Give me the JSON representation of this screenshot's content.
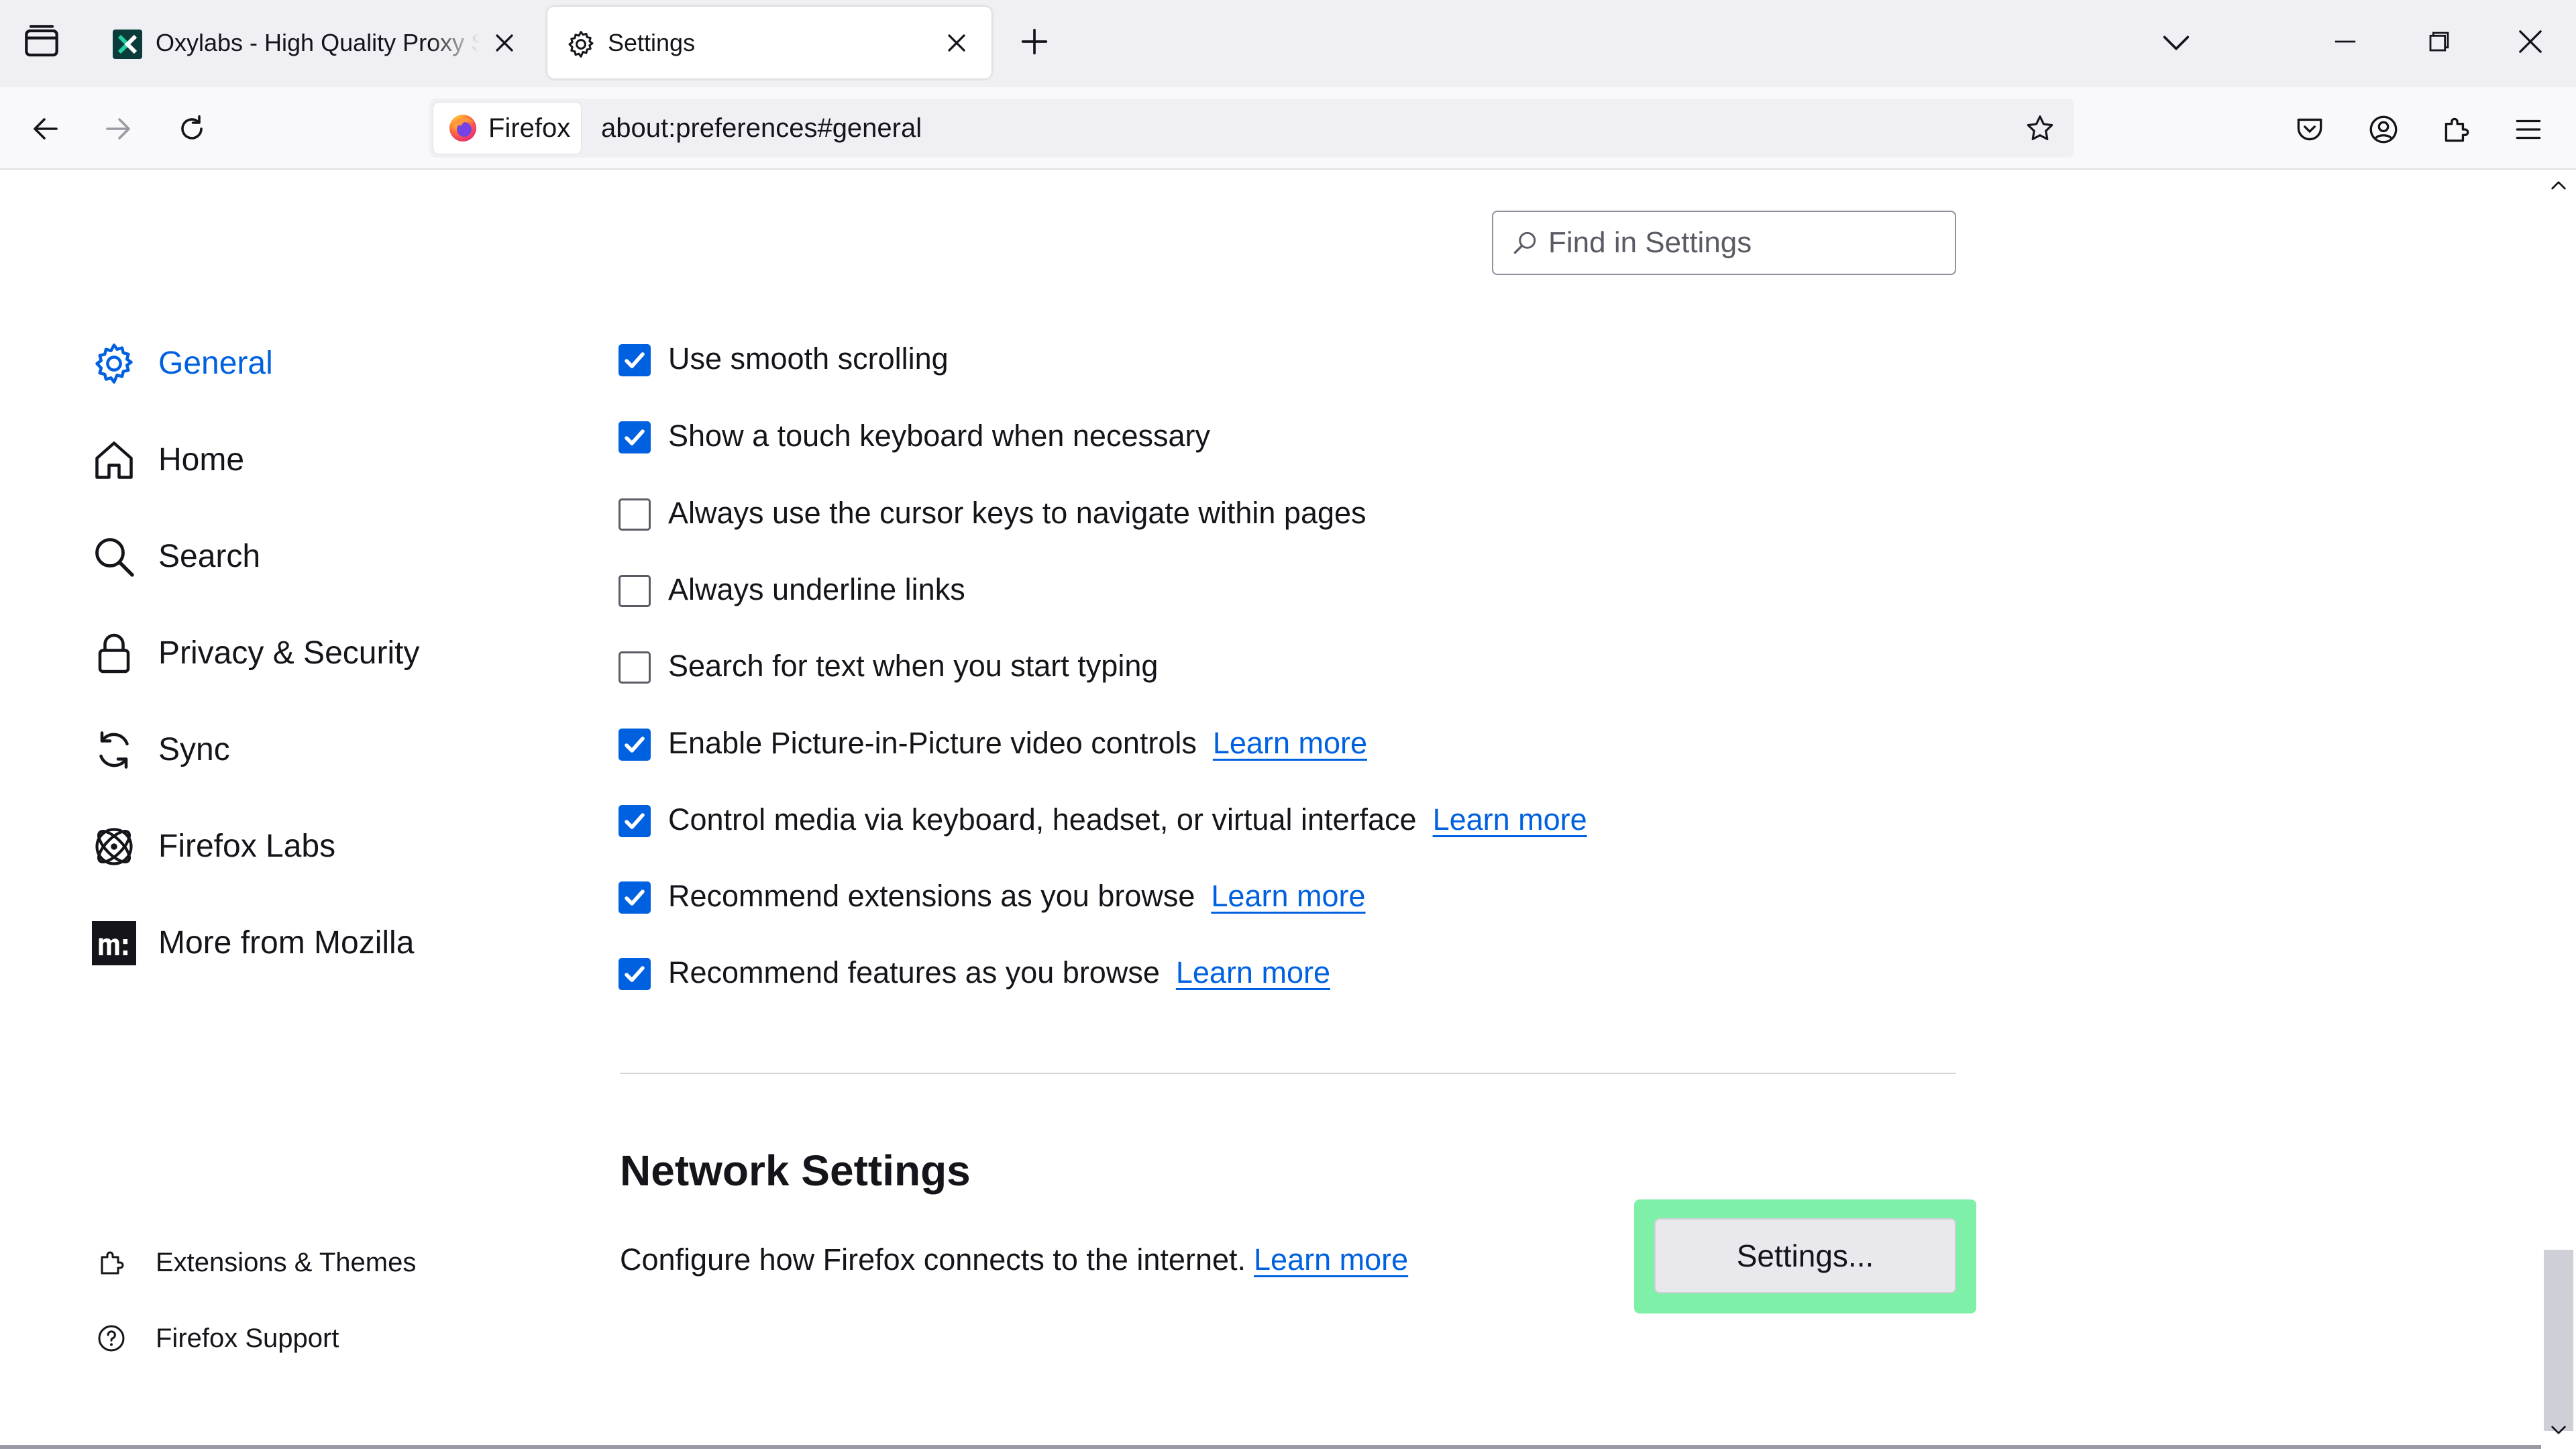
{
  "tabs": {
    "items": [
      {
        "title": "Oxylabs - High Quality Proxy Se",
        "active": false
      },
      {
        "title": "Settings",
        "active": true
      }
    ]
  },
  "navbar": {
    "identity_label": "Firefox",
    "url": "about:preferences#general"
  },
  "sidebar": {
    "categories": [
      {
        "label": "General",
        "icon": "gear-icon",
        "selected": true
      },
      {
        "label": "Home",
        "icon": "home-icon",
        "selected": false
      },
      {
        "label": "Search",
        "icon": "search-icon",
        "selected": false
      },
      {
        "label": "Privacy & Security",
        "icon": "lock-icon",
        "selected": false
      },
      {
        "label": "Sync",
        "icon": "sync-icon",
        "selected": false
      },
      {
        "label": "Firefox Labs",
        "icon": "atom-icon",
        "selected": false
      },
      {
        "label": "More from Mozilla",
        "icon": "mozilla-logo-icon",
        "selected": false
      }
    ],
    "footer": [
      {
        "label": "Extensions & Themes",
        "icon": "puzzle-icon"
      },
      {
        "label": "Firefox Support",
        "icon": "help-icon"
      }
    ]
  },
  "search": {
    "placeholder": "Find in Settings"
  },
  "options": [
    {
      "label": "Use smooth scrolling",
      "checked": true,
      "link": ""
    },
    {
      "label": "Show a touch keyboard when necessary",
      "checked": true,
      "link": ""
    },
    {
      "label": "Always use the cursor keys to navigate within pages",
      "checked": false,
      "link": ""
    },
    {
      "label": "Always underline links",
      "checked": false,
      "link": ""
    },
    {
      "label": "Search for text when you start typing",
      "checked": false,
      "link": ""
    },
    {
      "label": "Enable Picture-in-Picture video controls",
      "checked": true,
      "link": "Learn more"
    },
    {
      "label": "Control media via keyboard, headset, or virtual interface",
      "checked": true,
      "link": "Learn more"
    },
    {
      "label": "Recommend extensions as you browse",
      "checked": true,
      "link": "Learn more"
    },
    {
      "label": "Recommend features as you browse",
      "checked": true,
      "link": "Learn more"
    }
  ],
  "network": {
    "title": "Network Settings",
    "description": "Configure how Firefox connects to the internet.",
    "link": "Learn more",
    "button": "Settings..."
  },
  "colors": {
    "accent": "#0061e0",
    "highlight": "#7ff0a8",
    "tabstrip": "#f0f0f4"
  }
}
